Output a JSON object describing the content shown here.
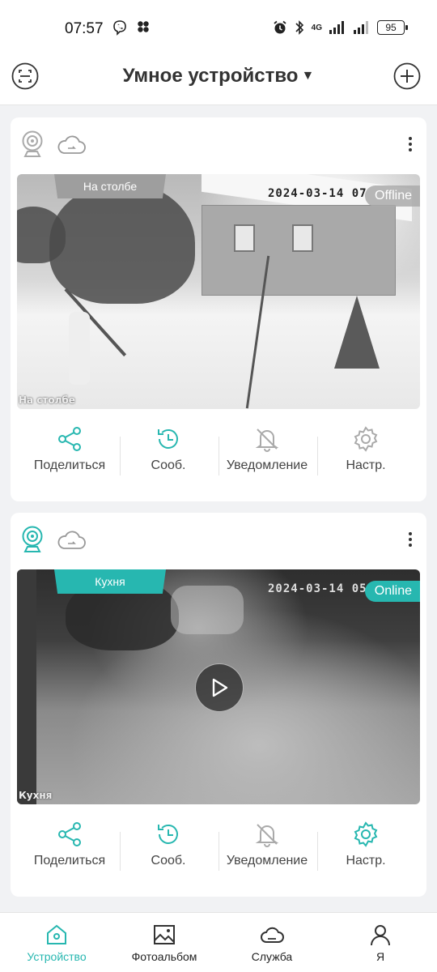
{
  "status_bar": {
    "time": "07:57",
    "network": "4G",
    "battery": "95"
  },
  "header": {
    "title": "Умное устройство",
    "caret": "▼"
  },
  "devices": [
    {
      "name": "На столбе",
      "status": "Offline",
      "osd_time": "2024-03-14 07",
      "osd_name": "На столбе",
      "actions": {
        "share": "Поделиться",
        "events": "Сооб.",
        "notifications": "Уведомление",
        "settings": "Настр."
      }
    },
    {
      "name": "Кухня",
      "status": "Online",
      "osd_time": "2024-03-14 05",
      "osd_name": "Кухня",
      "actions": {
        "share": "Поделиться",
        "events": "Сооб.",
        "notifications": "Уведомление",
        "settings": "Настр."
      }
    }
  ],
  "bottom_nav": [
    {
      "label": "Устройство",
      "icon": "house-icon",
      "active": true
    },
    {
      "label": "Фотоальбом",
      "icon": "photo-icon",
      "active": false
    },
    {
      "label": "Служба",
      "icon": "cloud-icon",
      "active": false
    },
    {
      "label": "Я",
      "icon": "person-icon",
      "active": false
    }
  ],
  "colors": {
    "accent": "#27b7b0",
    "offline_tag": "#9e9e9e",
    "background": "#f1f2f4"
  }
}
